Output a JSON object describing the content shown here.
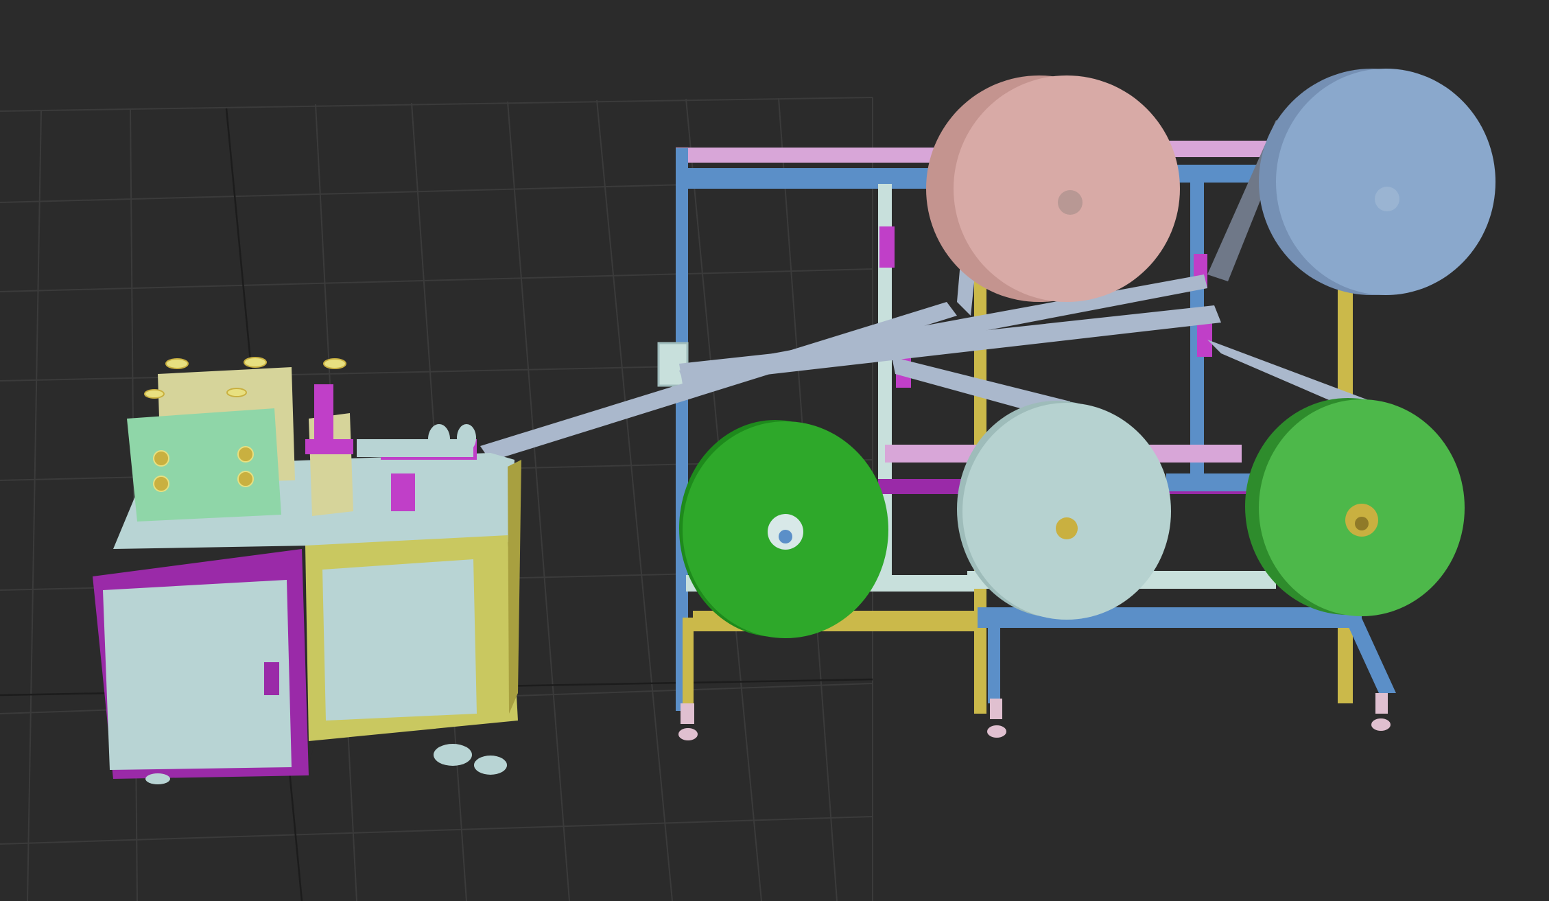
{
  "scene": {
    "background": "#2b2b2b",
    "grid_color": "#3b3b3b",
    "grid_axis_color": "#1a1a1a",
    "colors": {
      "cabinet_body": "#b8d4d4",
      "cabinet_door_frame": "#9a2aa8",
      "cabinet_side": "#c9c860",
      "head_unit": "#8fd6a8",
      "head_unit_back": "#d6d49a",
      "press_column": "#c03fc8",
      "frame_blue": "#5b8fc8",
      "frame_pink": "#d8a6d8",
      "frame_yellow": "#cbb94a",
      "frame_mint": "#c8e0dc",
      "web_material": "#aab8cc",
      "roll_pink": "#d8aaa6",
      "roll_blue": "#8aa8cc",
      "roll_green_dark": "#2ea82a",
      "roll_white": "#b6d2d0",
      "roll_green_light": "#4db84a",
      "hub_white": "#d8e8e8",
      "hub_yellow": "#c9b040",
      "foot": "#e0c0d0"
    }
  }
}
